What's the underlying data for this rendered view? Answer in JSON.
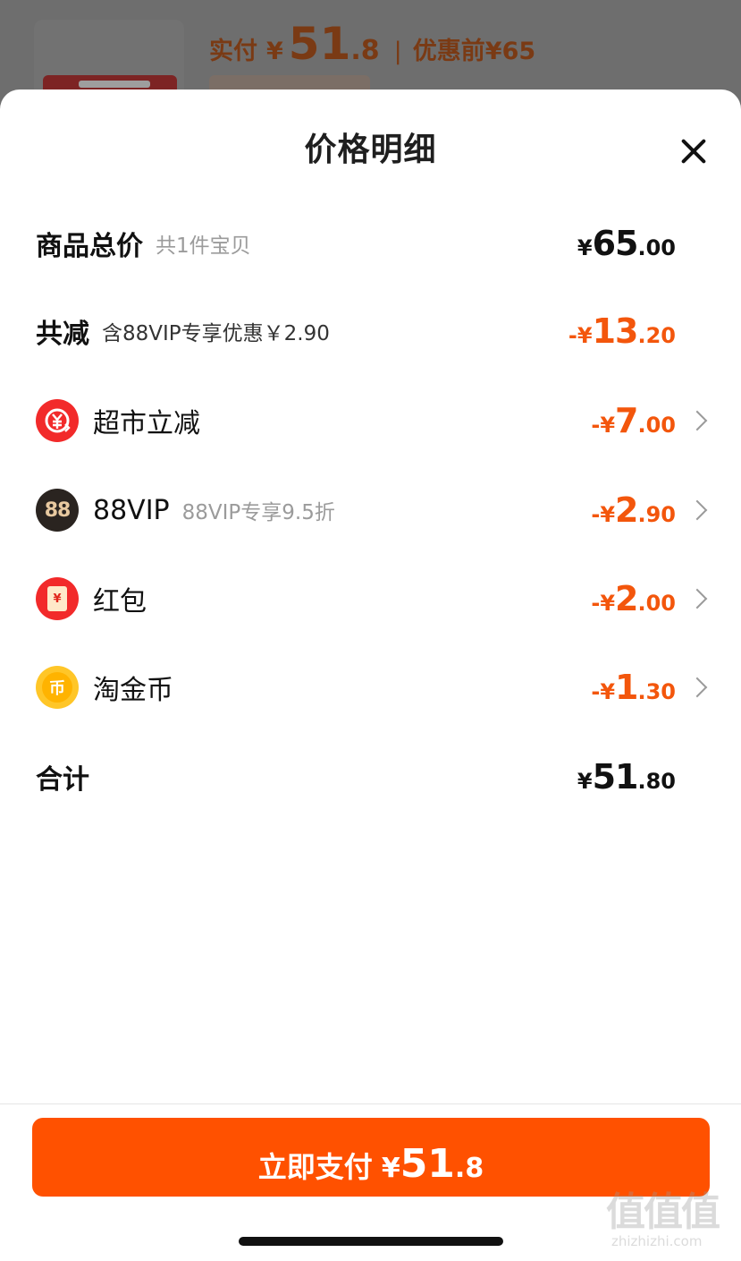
{
  "background": {
    "price_label": "实付",
    "price_currency": "¥",
    "price_int": "51",
    "price_dec": ".8",
    "separator": "|",
    "original_price": "优惠前¥65"
  },
  "sheet": {
    "title": "价格明细"
  },
  "rows": {
    "total": {
      "label": "商品总价",
      "sub": "共1件宝贝",
      "pre": "¥",
      "int": "65",
      "dec": ".00"
    },
    "discount": {
      "label": "共减",
      "sub": "含88VIP专享优惠￥2.90",
      "pre": "-¥",
      "int": "13",
      "dec": ".20"
    },
    "supermarket": {
      "label": "超市立减",
      "icon": "supermarket-discount-icon",
      "pre": "-¥",
      "int": "7",
      "dec": ".00"
    },
    "vip": {
      "label": "88VIP",
      "sub": "88VIP专享9.5折",
      "icon_text": "88",
      "icon": "88vip-icon",
      "pre": "-¥",
      "int": "2",
      "dec": ".90"
    },
    "redpacket": {
      "label": "红包",
      "icon": "red-packet-icon",
      "icon_text": "¥",
      "pre": "-¥",
      "int": "2",
      "dec": ".00"
    },
    "coins": {
      "label": "淘金币",
      "icon": "taojinbi-coin-icon",
      "icon_text": "币",
      "pre": "-¥",
      "int": "1",
      "dec": ".30"
    },
    "sum": {
      "label": "合计",
      "pre": "¥",
      "int": "51",
      "dec": ".80"
    }
  },
  "pay_button": {
    "label": "立即支付",
    "currency": "¥",
    "int": "51",
    "dec": ".8"
  },
  "watermark": {
    "mark": "值值值",
    "site": "zhizhizhi.com"
  },
  "colors": {
    "accent_orange": "#f3560c",
    "pay_button": "#ff5100"
  }
}
